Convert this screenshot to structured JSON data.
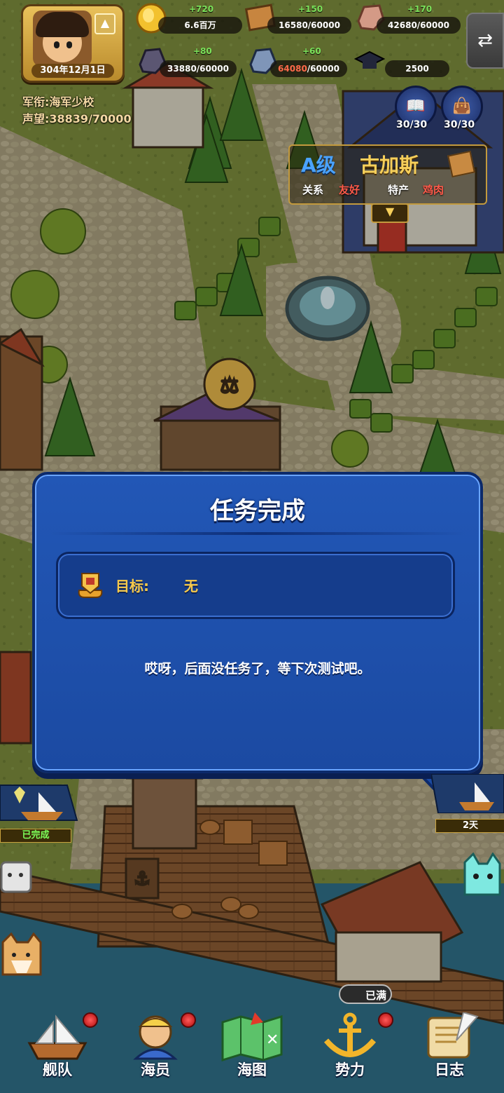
{
  "player": {
    "date": "304年12月1日",
    "rank_label": "军衔:海军少校",
    "fame_label": "声望:38839/70000"
  },
  "resources": {
    "gold": {
      "amount": "6.6百万",
      "plus": "+720"
    },
    "wood": {
      "amount": "16580/60000",
      "plus": "+150"
    },
    "stone": {
      "amount": "42680/60000",
      "plus": "+170"
    },
    "iron": {
      "amount": "33880/60000",
      "plus": "+80"
    },
    "crystal": {
      "amount": "64080",
      "amount_suffix": "/60000",
      "plus": "+60"
    },
    "academy": {
      "amount": "2500"
    }
  },
  "quick_buttons": {
    "book_count": "30/30",
    "bag_count": "30/30"
  },
  "city": {
    "grade": "A级",
    "name": "古加斯",
    "relation_label": "关系",
    "relation_value": "友好",
    "specialty_label": "特产",
    "specialty_value": "鸡肉"
  },
  "dialog": {
    "title": "任务完成",
    "goal_label": "目标:",
    "goal_value": "无",
    "message": "哎呀，后面没任务了，等下次测试吧。"
  },
  "side": {
    "left_status": "已完成",
    "right_timer": "2天"
  },
  "bottom_nav": {
    "fleet": "舰队",
    "crew": "海员",
    "chart": "海图",
    "faction": "势力",
    "log": "日志",
    "full_tag": "已满"
  },
  "colors": {
    "dialog_blue": "#1f50ac",
    "gold_text": "#f7c94a",
    "friendly_red": "#ff5a4a",
    "grade_blue": "#4aa3ff"
  }
}
